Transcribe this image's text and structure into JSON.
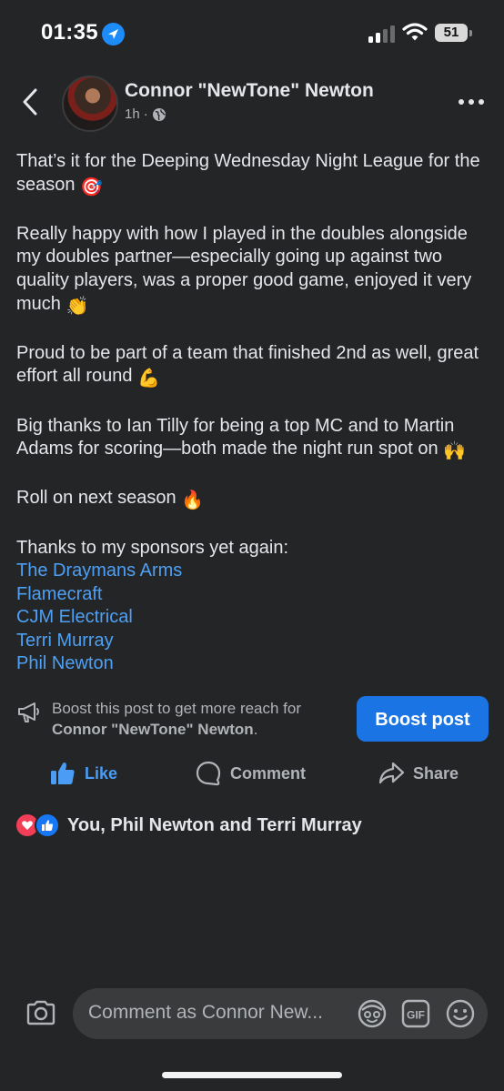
{
  "status_bar": {
    "time": "01:35",
    "battery": "51"
  },
  "post": {
    "author": "Connor \"NewTone\" Newton",
    "time_ago": "1h",
    "separator": "·",
    "paragraphs": [
      {
        "text": "That’s it for the Deeping Wednesday Night League for the season ",
        "emoji": "🎯"
      },
      {
        "text": "Really happy with how I played in the doubles alongside my doubles partner—especially going up against two quality players, was a proper good game, enjoyed it very much ",
        "emoji": "👏"
      },
      {
        "text": "Proud to be part of a team that finished 2nd as well, great effort all round ",
        "emoji": "💪"
      },
      {
        "text": "Big thanks to Ian Tilly for being a top MC and to Martin Adams for scoring—both made the night run spot on ",
        "emoji": "🙌"
      },
      {
        "text": "Roll on next season ",
        "emoji": "🔥"
      }
    ],
    "sponsors_intro": "Thanks to my sponsors yet again:",
    "sponsors": [
      "The Draymans Arms",
      "Flamecraft",
      "CJM Electrical",
      "Terri Murray",
      "Phil Newton"
    ]
  },
  "boost": {
    "prefix": "Boost this post to get more reach for",
    "name": "Connor \"NewTone\" Newton",
    "suffix": ".",
    "button_label": "Boost post"
  },
  "actions": {
    "like": "Like",
    "comment": "Comment",
    "share": "Share"
  },
  "reactions": {
    "summary": "You, Phil Newton and Terri Murray",
    "icons": [
      "love",
      "like"
    ]
  },
  "composer": {
    "placeholder": "Comment as Connor New..."
  },
  "colors": {
    "background": "#242526",
    "link": "#4ea0f5",
    "accent": "#1b74e4",
    "love": "#f33e58"
  }
}
